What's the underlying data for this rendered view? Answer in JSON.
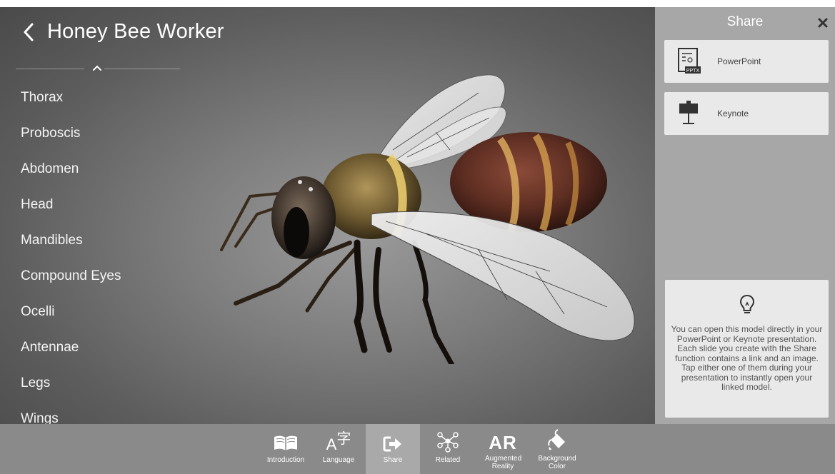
{
  "header": {
    "title": "Honey Bee Worker"
  },
  "parts": [
    "Thorax",
    "Proboscis",
    "Abdomen",
    "Head",
    "Mandibles",
    "Compound Eyes",
    "Ocelli",
    "Antennae",
    "Legs",
    "Wings"
  ],
  "share": {
    "title": "Share",
    "items": [
      {
        "label": "PowerPoint",
        "icon": "powerpoint-icon",
        "badge": "PPTX"
      },
      {
        "label": "Keynote",
        "icon": "keynote-icon"
      }
    ],
    "tip": "You can open this model directly in your PowerPoint or Keynote presentation. Each slide you create with the Share function contains a link and an image. Tap either one of them during your presentation to instantly open your linked model."
  },
  "toolbar": {
    "items": [
      {
        "label": "Introduction",
        "icon": "book-icon"
      },
      {
        "label": "Language",
        "icon": "language-icon",
        "glyph_a": "A",
        "glyph_b": "字"
      },
      {
        "label": "Share",
        "icon": "share-icon",
        "active": true
      },
      {
        "label": "Related",
        "icon": "related-icon"
      },
      {
        "label": "Augmented Reality",
        "icon": "ar-icon",
        "glyph": "AR"
      },
      {
        "label": "Background Color",
        "icon": "paint-bucket-icon"
      }
    ]
  },
  "colors": {
    "viewer_bg": "#6b6b6b",
    "panel_bg": "#a7a7a7",
    "toolbar_bg": "#8a8a8a",
    "active_tab": "#a9a9a9",
    "card_bg": "#e9e9e9"
  }
}
